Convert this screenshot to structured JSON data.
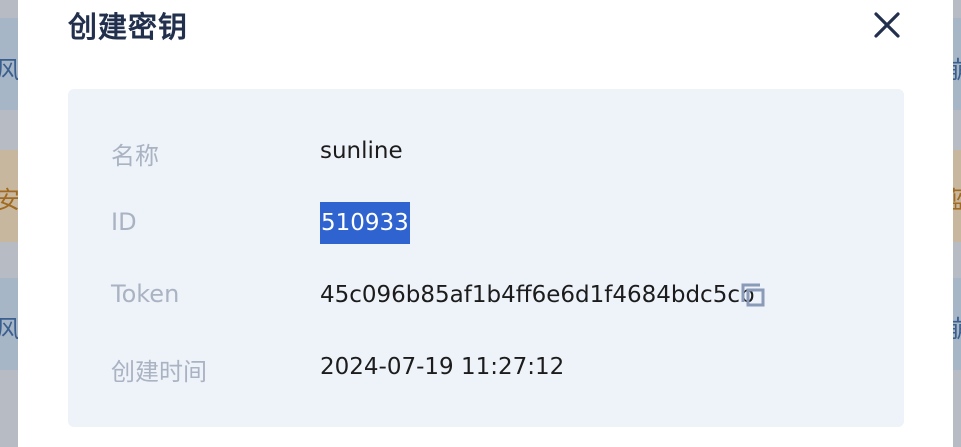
{
  "background": {
    "rows": [
      {
        "left_text": "风",
        "right_text": "崩"
      },
      {
        "left_text": "安",
        "right_text": "蓝"
      },
      {
        "left_text": "风",
        "right_text": "崩"
      }
    ]
  },
  "dialog": {
    "title": "创建密钥",
    "close_icon": "close-icon"
  },
  "details": {
    "name_label": "名称",
    "name_value": "sunline",
    "id_label": "ID",
    "id_value": "510933",
    "token_label": "Token",
    "token_value": "45c096b85af1b4ff6e6d1f4684bdc5cb",
    "created_label": "创建时间",
    "created_value": "2024-07-19 11:27:12"
  },
  "colors": {
    "title": "#22304d",
    "panel_bg": "#eef2f9",
    "label": "#aab3c2",
    "selection": "#2f63cf"
  }
}
